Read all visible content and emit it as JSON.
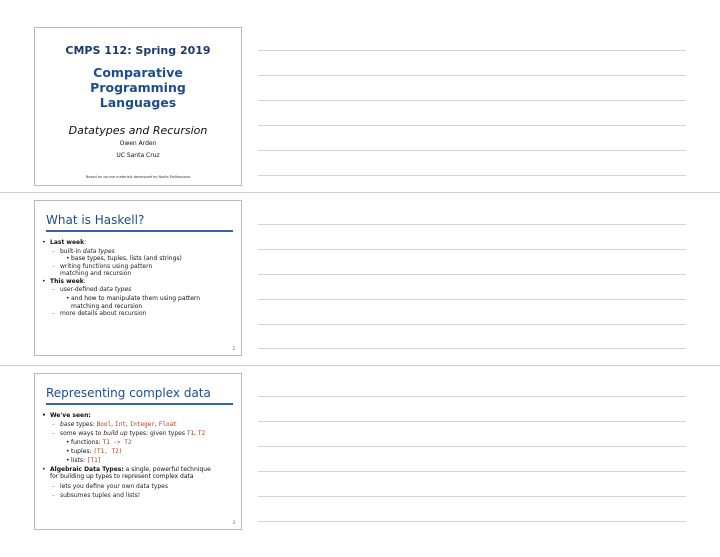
{
  "slide1": {
    "course": "CMPS 112: Spring 2019",
    "title_line1": "Comparative Programming",
    "title_line2": "Languages",
    "subtitle": "Datatypes and Recursion",
    "author": "Owen Arden",
    "institution": "UC Santa Cruz",
    "credit": "Based on course materials developed by Nadia Polikarpova"
  },
  "slide2": {
    "title": "What is Haskell?",
    "page": "2",
    "last_week": "Last week",
    "colon": ":",
    "builtin_prefix": "built-in ",
    "builtin_em": "data types",
    "base_types": "base types, tuples, lists (and strings)",
    "writing_l1": "writing functions using pattern",
    "writing_l2": "matching and recursion",
    "this_week": "This week",
    "userdef_prefix": "user-defined ",
    "userdef_em": "data types",
    "manip_l1": "and how to manipulate them using pattern",
    "manip_l2": "matching and recursion",
    "more": "more details about recursion"
  },
  "slide3": {
    "title": "Representing complex data",
    "page": "3",
    "seen": "We've seen:",
    "base_em": "base",
    "base_text": " types: ",
    "t_bool": "Bool",
    "t_int": "Int",
    "t_integer": "Integer",
    "t_float": "Float",
    "comma": ", ",
    "ways_prefix": "some ways to ",
    "ways_em": "build up",
    "ways_mid": " types: given types ",
    "t1": "T1",
    "t2": "T2",
    "functions_label": "functions: ",
    "fn_type": "T1 -> T2",
    "tuples_label": "tuples: ",
    "tuple_type": "(T1, T2)",
    "lists_label": "lists: ",
    "list_type": "[T1]",
    "adt_bold": "Algebraic Data Types:",
    "adt_text_l1": " a single, powerful technique",
    "adt_text_l2": "for building up types to represent complex data",
    "define": "lets you define your own data types",
    "subsumes": "subsumes tuples and lists!"
  }
}
